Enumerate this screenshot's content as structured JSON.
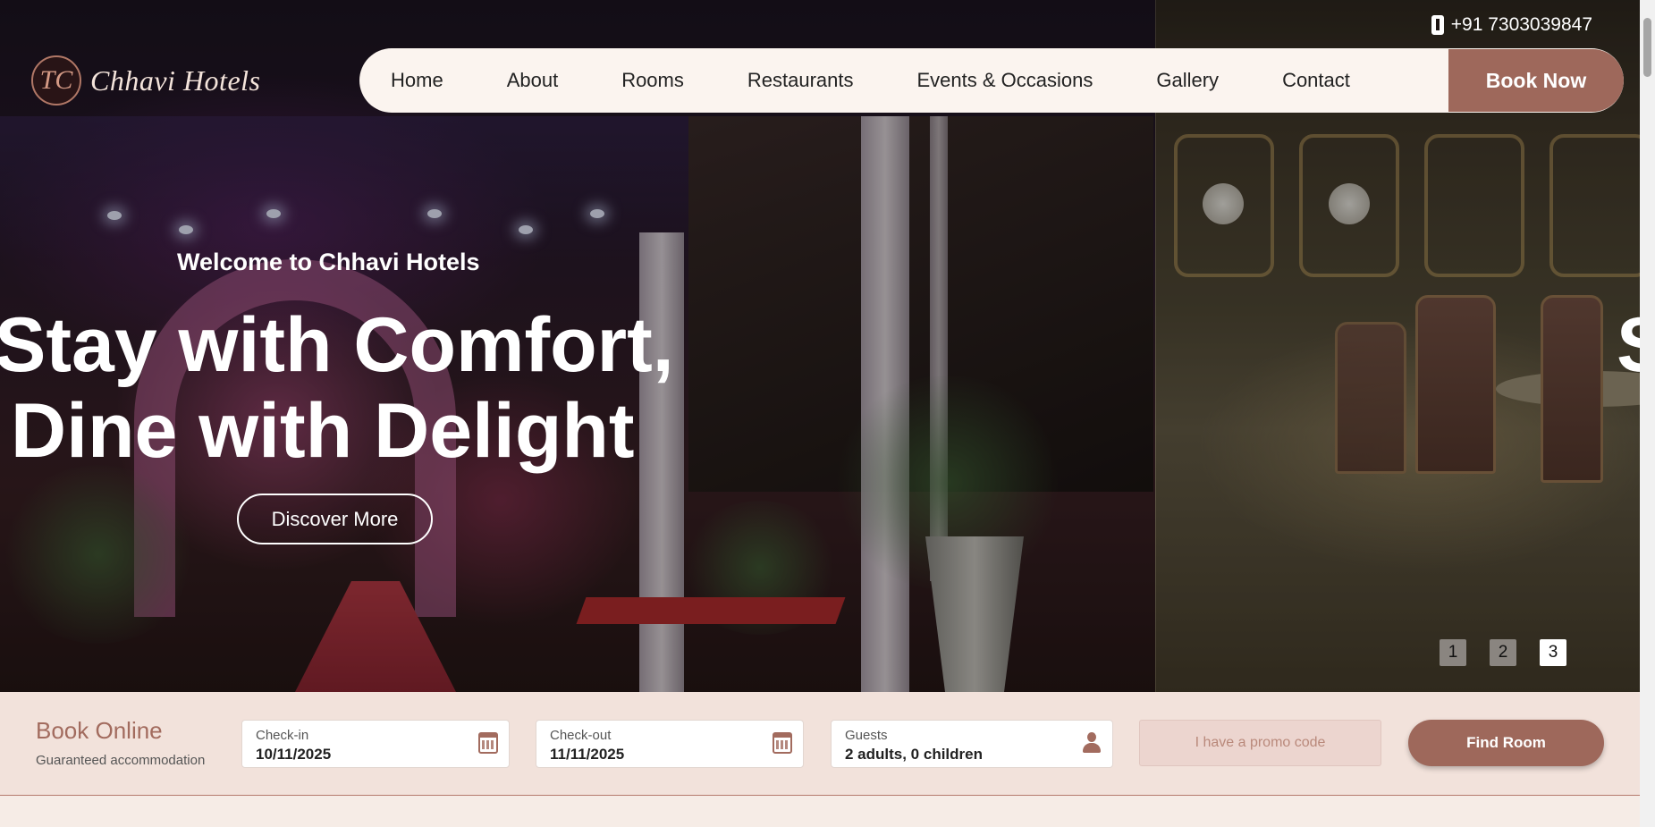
{
  "topbar": {
    "phone_icon": "mobile-phone-icon",
    "phone": "+91 7303039847"
  },
  "brand": {
    "logo_mark": "TC",
    "name": "Chhavi Hotels"
  },
  "nav": {
    "items": [
      "Home",
      "About",
      "Rooms",
      "Restaurants",
      "Events & Occasions",
      "Gallery",
      "Contact"
    ],
    "cta": "Book Now"
  },
  "hero": {
    "eyebrow": "Welcome to Chhavi Hotels",
    "headline_line1": "Stay with Comfort,",
    "headline_line2": "Dine with Delight",
    "cta": "Discover More",
    "next_slide_peek": "S",
    "slider_dots": [
      "1",
      "2",
      "3"
    ],
    "active_dot": "3"
  },
  "booking": {
    "title": "Book Online",
    "subtitle": "Guaranteed accommodation",
    "checkin": {
      "label": "Check-in",
      "value": "10/11/2025",
      "icon": "calendar-icon"
    },
    "checkout": {
      "label": "Check-out",
      "value": "11/11/2025",
      "icon": "calendar-icon"
    },
    "guests": {
      "label": "Guests",
      "value": "2 adults, 0 children",
      "icon": "person-icon"
    },
    "promo_placeholder": "I have a promo code",
    "submit": "Find Room"
  },
  "colors": {
    "accent": "#9e685b",
    "nav_bg": "#fbf4ef",
    "booking_bg": "#f1e1db"
  }
}
